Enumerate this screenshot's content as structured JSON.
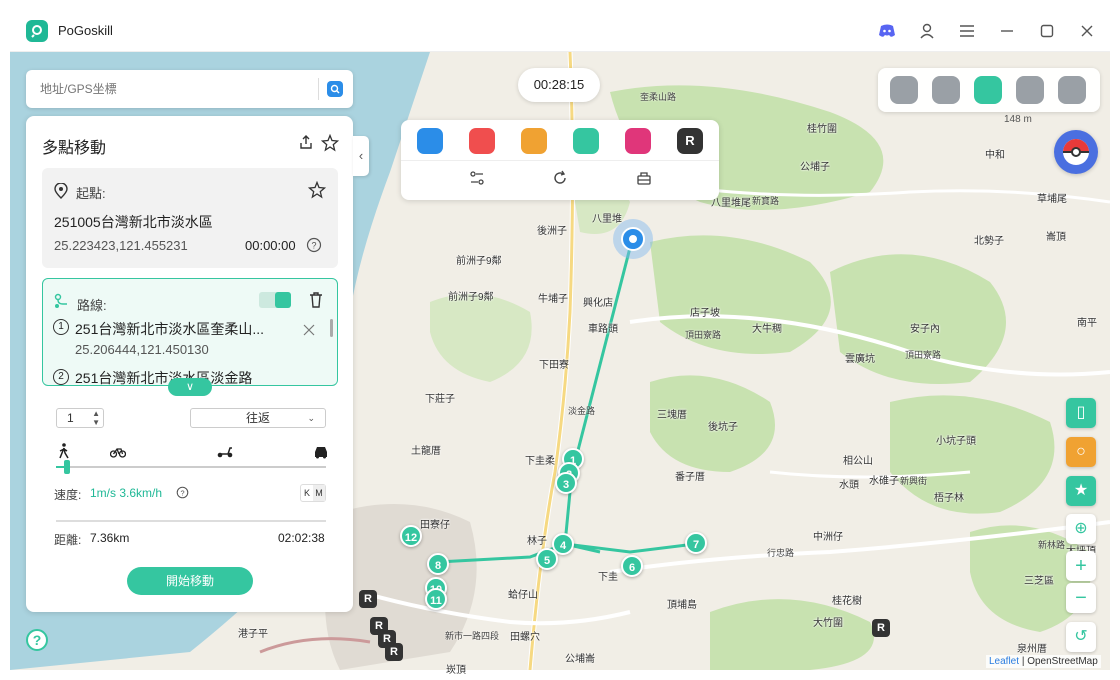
{
  "app": {
    "name": "PoGoskill"
  },
  "search": {
    "placeholder": "地址/GPS坐標"
  },
  "timer": "00:28:15",
  "panel": {
    "title": "多點移動",
    "start": {
      "label": "起點:",
      "address": "251005台灣新北市淡水區",
      "coords": "25.223423,121.455231",
      "time": "00:00:00"
    },
    "route": {
      "label": "路線:",
      "items": [
        {
          "index": "1",
          "address": "251台灣新北市淡水區奎柔山...",
          "coords": "25.206444,121.450130"
        },
        {
          "index": "2",
          "address": "251台灣新北市淡水區淡金路",
          "coords": ""
        }
      ]
    },
    "repeat_count": "1",
    "loop_mode": "往返",
    "speed_label": "速度:",
    "speed_value": "1m/s 3.6km/h",
    "speed_fraction": 0.04,
    "unit_toggle": [
      "K",
      "M"
    ],
    "distance_label": "距離:",
    "distance_value": "7.36km",
    "duration": "02:02:38",
    "start_button": "開始移動"
  },
  "map": {
    "places": [
      "桂竹圍",
      "公埔子",
      "八里堆尾",
      "新寶路",
      "草埔尾",
      "北勢子",
      "崙頂",
      "後洲子",
      "八里堆",
      "前洲子9鄰",
      "前洲子9鄰",
      "牛埔子",
      "興化店",
      "車路頭",
      "店子坡",
      "頂田寮路",
      "大牛稠",
      "安子內",
      "南平",
      "雲廣坑",
      "頂田寮路",
      "下田寮",
      "下莊子",
      "三塊厝",
      "後坑子",
      "小坑子頭",
      "土龍厝",
      "下圭柔",
      "番子厝",
      "相公山",
      "水頭",
      "水碓子",
      "新興街",
      "梧子林",
      "田寮仔",
      "林子",
      "頂埔島",
      "下圭",
      "行忠路",
      "中洲仔",
      "新林路",
      "大坪頂",
      "蛤仔山",
      "三芝區",
      "桂花樹",
      "大竹圍",
      "泉州厝",
      "港子平",
      "新市一路四段",
      "田螺穴",
      "公埔崙",
      "崁頂",
      "淡金路",
      "中和",
      "奎柔山路"
    ],
    "elevation": "148 m",
    "attribution_leaflet": "Leaflet",
    "attribution_osm": "OpenStreetMap",
    "markers": [
      "1",
      "2",
      "3",
      "4",
      "5",
      "6",
      "7",
      "8",
      "10",
      "11",
      "12"
    ],
    "npc_badge": "R"
  },
  "tools": {
    "app_colors": [
      "#2b8de8",
      "#f04e4e",
      "#f0a232",
      "#35c6a0",
      "#e0367a",
      "#333333"
    ],
    "app_badge": "R"
  },
  "accent_color": "#35c6a0"
}
